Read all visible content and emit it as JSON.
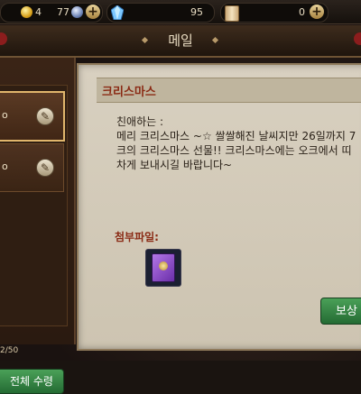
{
  "topbar": {
    "energy": "4",
    "energy_max": "77",
    "gems": "95",
    "scrolls": "0",
    "plus": "+"
  },
  "header": {
    "title": "메일"
  },
  "sidebar": {
    "claim_all_button": "전체 수령",
    "footer_text": "2/50"
  },
  "mail": {
    "subject": "크리스마스",
    "greeting": "친애하는  :",
    "body_line1": "메리 크리스마스 ~☆ 쌀쌀해진 날씨지만 26일까지 7",
    "body_line2": "크의 크리스마스 선물!! 크리스마스에는 오크에서 띠",
    "body_line3": "차게 보내시길 바랍니다~",
    "attachment_label": "첨부파일:",
    "reward_button": "보상"
  },
  "colors": {
    "accent_green": "#3a8a48",
    "subject_red": "#8a2a14",
    "gold": "#e0b66c"
  }
}
